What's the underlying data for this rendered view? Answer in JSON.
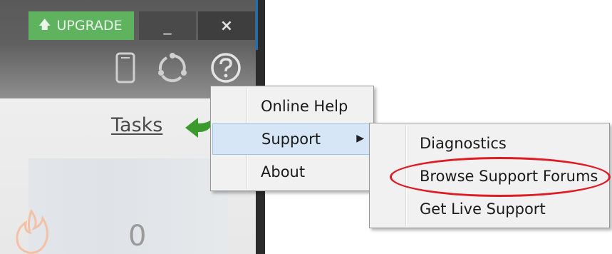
{
  "titlebar": {
    "upgrade_label": "UPGRADE",
    "upgrade_icon": "arrow-up-icon",
    "minimize_label": "_",
    "close_label": "×",
    "icons": [
      "phone-icon",
      "sync-icon",
      "help-icon"
    ]
  },
  "main": {
    "tasks_label": "Tasks",
    "count_value": "0"
  },
  "menu": {
    "items": [
      {
        "label": "Online Help"
      },
      {
        "label": "Support",
        "has_submenu": true
      },
      {
        "label": "About"
      }
    ],
    "submenu_arrow": "▶"
  },
  "submenu": {
    "items": [
      {
        "label": "Diagnostics"
      },
      {
        "label": "Browse Support Forums"
      },
      {
        "label": "Get Live Support"
      }
    ]
  },
  "colors": {
    "upgrade_green": "#5fb35f",
    "menu_highlight": "#d6e6f6",
    "annotation_red": "#e01b24"
  }
}
